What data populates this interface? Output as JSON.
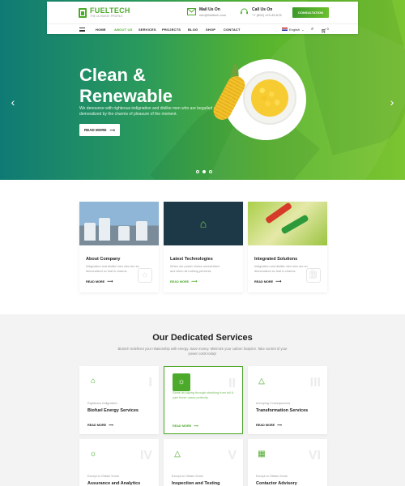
{
  "colors": {
    "accent": "#4caa2b",
    "hero_start": "#0f7a74",
    "hero_end": "#7cc431"
  },
  "header": {
    "logo_name": "FUELTECH",
    "logo_tagline": "THE ULTIMATE PROFILE",
    "mail": {
      "title": "Mail Us On",
      "value": "info@fueltech.com",
      "icon": "mail-icon"
    },
    "call": {
      "title": "Call Us On",
      "value": "+7 (800) 123-45-678",
      "icon": "headset-icon"
    },
    "consult_label": "CONSULTATION"
  },
  "nav": {
    "items": [
      "HOME",
      "ABOUT US",
      "SERVICES",
      "PROJECTS",
      "BLOG",
      "SHOP",
      "CONTACT"
    ],
    "active_index": 1,
    "language": "English",
    "cart_count": "0"
  },
  "hero": {
    "title": "Clean & Renewable",
    "text": "We denounce with righteous indignation and dislike men who are beguiled and demoralized by the charms of pleasure of the moment.",
    "button_label": "READ MORE",
    "slide_count": 3,
    "active_slide": 1
  },
  "cards": [
    {
      "title": "About Company",
      "text": "Indignation and dislike men who are so demoralized so that is charms.",
      "link": "READ MORE"
    },
    {
      "title": "Latest Technologies",
      "text": "When our power choice unrestricted and when all nothing prevents.",
      "link": "READ MORE"
    },
    {
      "title": "Integrated Solutions",
      "text": "Indignation and dislike men who are so demoralized so that is charms.",
      "link": "READ MORE"
    }
  ],
  "services": {
    "heading_light": "Our Dedicated",
    "heading_bold": "Services",
    "subtitle": "Biotech redefines your relationship with energy. Save money. Minimize your carbon footprint. Take control of your power costs today!",
    "items": [
      {
        "numeral": "I",
        "small": "Righteous Indignation",
        "title": "Biofuel Energy Services",
        "link": "READ MORE",
        "icon": "factory-icon"
      },
      {
        "numeral": "II",
        "small": "Same as saying through shrinking from toil & pain these cases perfectly.",
        "title": "",
        "link": "READ MORE",
        "icon": "lightbulb-icon",
        "highlight": true
      },
      {
        "numeral": "III",
        "small": "Annoying Consequences",
        "title": "Transformation Services",
        "link": "READ MORE",
        "icon": "energy-icon"
      },
      {
        "numeral": "IV",
        "small": "Except to Obtain Some",
        "title": "Assurance and Analytics",
        "icon": "bulb-icon"
      },
      {
        "numeral": "V",
        "small": "Except to Obtain Some",
        "title": "Inspection and Testing",
        "icon": "bolt-icon"
      },
      {
        "numeral": "VI",
        "small": "Except to Obtain Some",
        "title": "Contactor Advisory",
        "icon": "chart-icon"
      }
    ]
  }
}
